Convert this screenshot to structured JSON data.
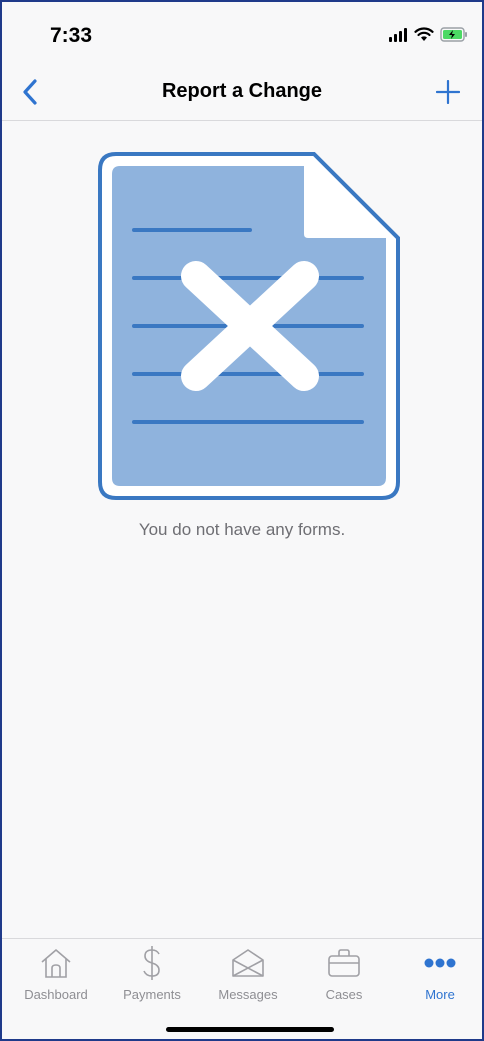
{
  "status_bar": {
    "time": "7:33",
    "icons": [
      "signal-icon",
      "wifi-icon",
      "battery-charging-icon"
    ]
  },
  "nav": {
    "title": "Report a Change",
    "back_icon": "chevron-left-icon",
    "add_icon": "plus-icon"
  },
  "empty_state": {
    "illustration": "document-x-icon",
    "message": "You do not have any forms."
  },
  "tab_bar": {
    "items": [
      {
        "label": "Dashboard",
        "icon": "home-icon",
        "active": false
      },
      {
        "label": "Payments",
        "icon": "dollar-icon",
        "active": false
      },
      {
        "label": "Messages",
        "icon": "envelope-icon",
        "active": false
      },
      {
        "label": "Cases",
        "icon": "briefcase-icon",
        "active": false
      },
      {
        "label": "More",
        "icon": "more-dots-icon",
        "active": true
      }
    ]
  },
  "colors": {
    "accent": "#2f74d0",
    "illustration_fill": "#8fb3dd",
    "illustration_stroke": "#3a78c2",
    "inactive": "#8e8e93"
  }
}
